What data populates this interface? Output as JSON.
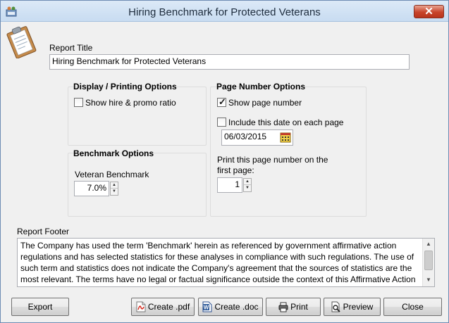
{
  "window": {
    "title": "Hiring Benchmark for Protected Veterans",
    "close_glyph": "✕"
  },
  "report_title": {
    "label": "Report Title",
    "value": "Hiring Benchmark for Protected Veterans"
  },
  "display_options": {
    "title": "Display / Printing Options",
    "show_hire_promo": {
      "label": "Show hire & promo ratio",
      "checked": false
    }
  },
  "benchmark_options": {
    "title": "Benchmark Options",
    "veteran_label": "Veteran Benchmark",
    "veteran_value": "7.0%"
  },
  "page_number_options": {
    "title": "Page Number Options",
    "show_page_number": {
      "label": "Show page number",
      "checked": true
    },
    "include_date": {
      "label": "Include this date on each page",
      "checked": false
    },
    "date_value": "06/03/2015",
    "first_page_label_1": "Print this page number on the",
    "first_page_label_2": "first page:",
    "first_page_value": "1"
  },
  "report_footer": {
    "label": "Report Footer",
    "text": "The Company has used the term 'Benchmark' herein as referenced by government affirmative action regulations and has selected statistics for these analyses in compliance with such regulations. The use of such term and statistics does not indicate the Company's agreement that the sources of statistics are the most relevant. The terms have no legal or factual significance outside the context of this Affirmative Action Program and in no way suggest any wrong doing by the Company."
  },
  "buttons": {
    "export": "Export",
    "create_pdf": "Create .pdf",
    "create_doc": "Create .doc",
    "print": "Print",
    "preview": "Preview",
    "close": "Close"
  },
  "icons": {
    "app": "app-icon",
    "clipboard": "clipboard-icon",
    "calendar": "calendar-icon",
    "pdf": "pdf-icon",
    "word": "word-icon",
    "printer": "printer-icon",
    "preview": "preview-icon"
  },
  "colors": {
    "title_bar": "#c8dcf1",
    "close_button": "#c7432a",
    "window_bg": "#f0f0f0"
  }
}
